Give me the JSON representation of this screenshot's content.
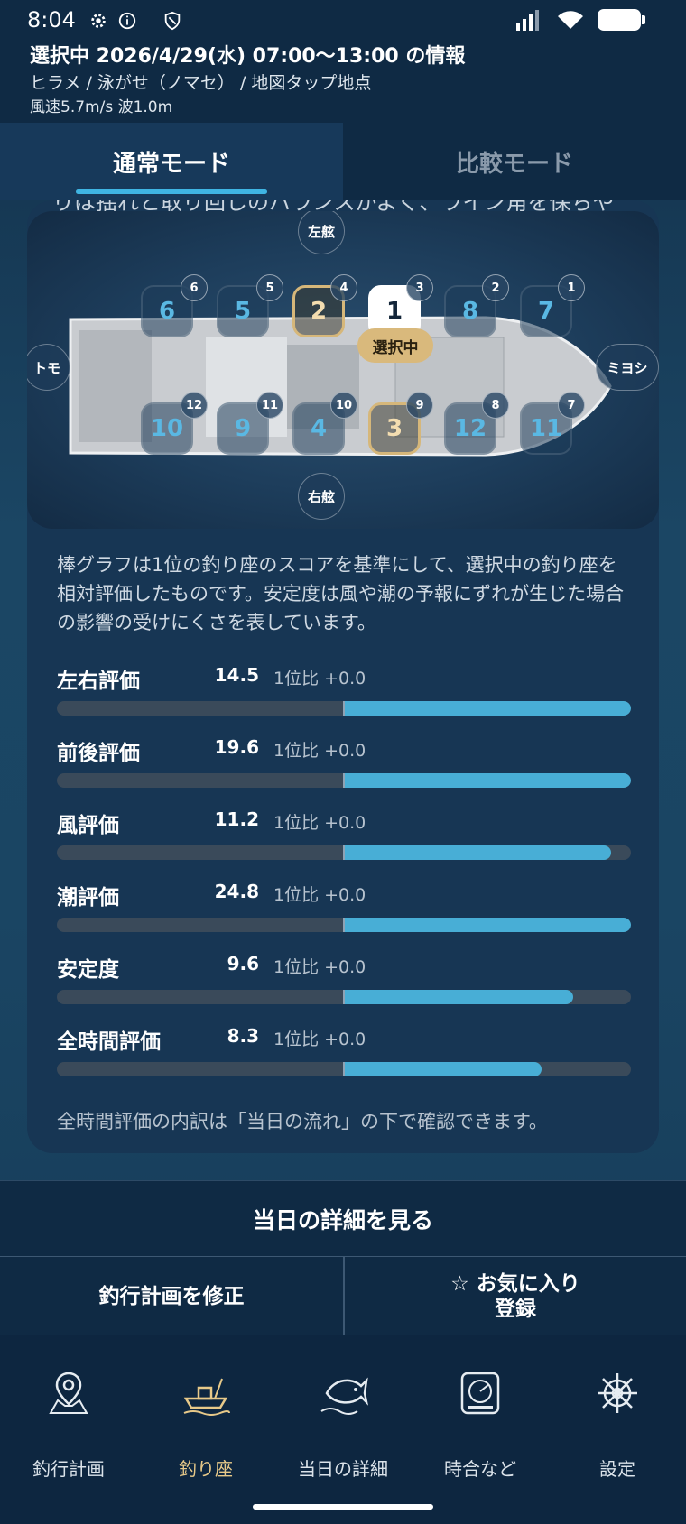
{
  "status_bar": {
    "time": "8:04"
  },
  "info": {
    "line1": "選択中 2026/4/29(水) 07:00〜13:00 の情報",
    "line2": "ヒラメ / 泳がせ（ノマセ） / 地図タップ地点",
    "line3": "風速5.7m/s  波1.0m"
  },
  "tabs": [
    {
      "label": "通常モード",
      "active": true
    },
    {
      "label": "比較モード",
      "active": false
    }
  ],
  "clipped_text": "りは揺れと取り回しのバランスがよく、ライン角を保ちや",
  "diagram": {
    "port": "左舷",
    "starboard": "右舷",
    "stern": "トモ",
    "bow": "ミヨシ",
    "selected_badge": "選択中",
    "top_row": [
      {
        "rank": "6",
        "seat": "6"
      },
      {
        "rank": "5",
        "seat": "5"
      },
      {
        "rank": "2",
        "seat": "4"
      },
      {
        "rank": "1",
        "seat": "3"
      },
      {
        "rank": "8",
        "seat": "2"
      },
      {
        "rank": "7",
        "seat": "1"
      }
    ],
    "bottom_row": [
      {
        "rank": "10",
        "seat": "12"
      },
      {
        "rank": "9",
        "seat": "11"
      },
      {
        "rank": "4",
        "seat": "10"
      },
      {
        "rank": "3",
        "seat": "9"
      },
      {
        "rank": "12",
        "seat": "8"
      },
      {
        "rank": "11",
        "seat": "7"
      }
    ]
  },
  "description": "棒グラフは1位の釣り座のスコアを基準にして、選択中の釣り座を相対評価したものです。安定度は風や潮の予報にずれが生じた場合の影響の受けにくさを表しています。",
  "metrics": [
    {
      "name": "左右評価",
      "value": "14.5",
      "compare": "1位比 +0.0",
      "fill_fraction": 1.0
    },
    {
      "name": "前後評価",
      "value": "19.6",
      "compare": "1位比 +0.0",
      "fill_fraction": 1.0
    },
    {
      "name": "風評価",
      "value": "11.2",
      "compare": "1位比 +0.0",
      "fill_fraction": 0.93
    },
    {
      "name": "潮評価",
      "value": "24.8",
      "compare": "1位比 +0.0",
      "fill_fraction": 1.0
    },
    {
      "name": "安定度",
      "value": "9.6",
      "compare": "1位比 +0.0",
      "fill_fraction": 0.8
    },
    {
      "name": "全時間評価",
      "value": "8.3",
      "compare": "1位比 +0.0",
      "fill_fraction": 0.69
    }
  ],
  "footnote": "全時間評価の内訳は「当日の流れ」の下で確認できます。",
  "actions": {
    "detail": "当日の詳細を見る",
    "edit_plan": "釣行計画を修正",
    "favorite_line1": "☆ お気に入り",
    "favorite_line2": "登録"
  },
  "nav": [
    {
      "label": "釣行計画",
      "icon": "map-pin-icon",
      "active": false
    },
    {
      "label": "釣り座",
      "icon": "boat-icon",
      "active": true
    },
    {
      "label": "当日の詳細",
      "icon": "fish-icon",
      "active": false
    },
    {
      "label": "時合など",
      "icon": "sonar-icon",
      "active": false
    },
    {
      "label": "設定",
      "icon": "helm-icon",
      "active": false
    }
  ],
  "colors": {
    "accent": "#48aed6",
    "gold": "#d9b97c",
    "background": "#0f2a44"
  }
}
